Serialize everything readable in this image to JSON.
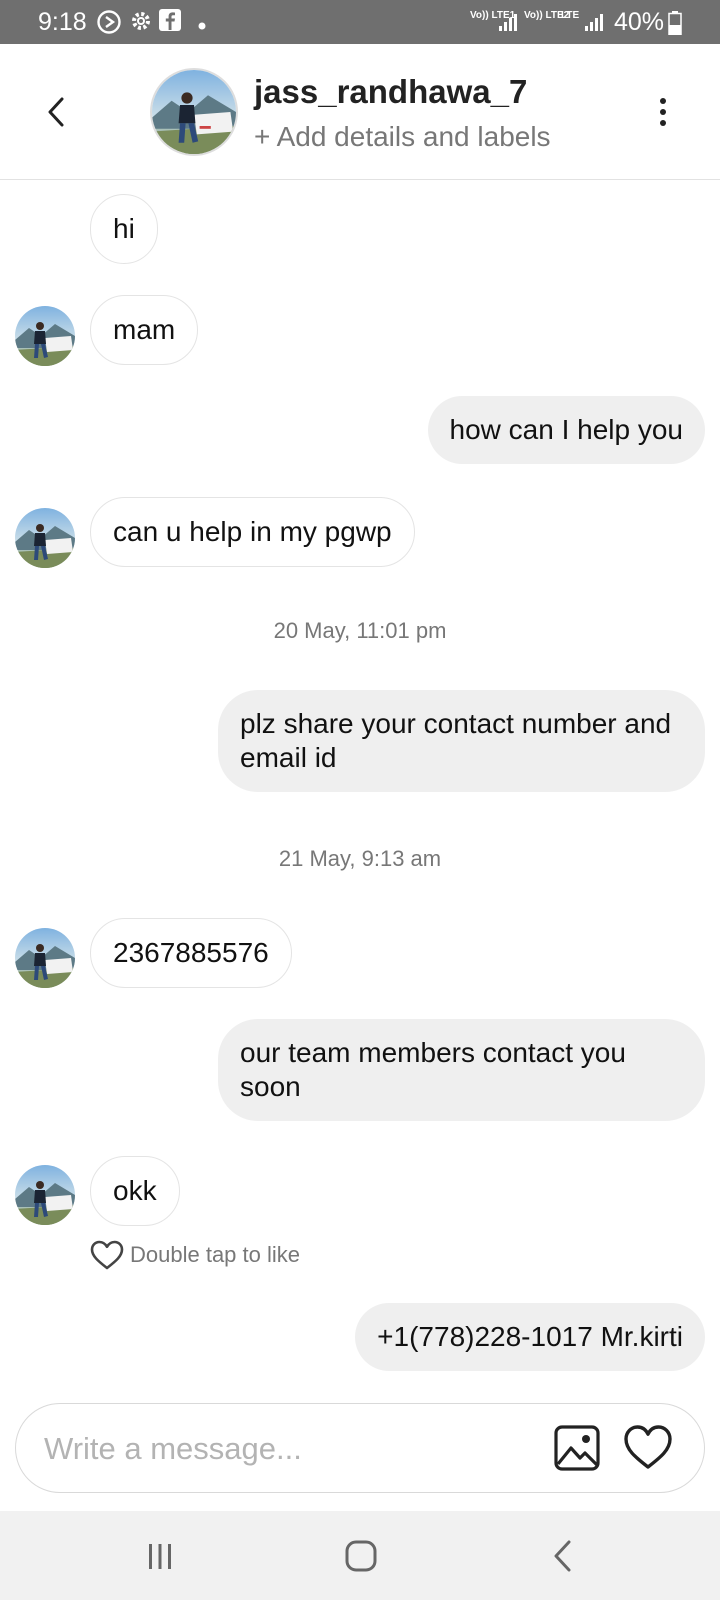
{
  "status_bar": {
    "time": "9:18",
    "battery": "40%",
    "sim1": "Vo)) LTE1",
    "sim2": "Vo)) LTE2",
    "network": "LTE",
    "icons": [
      "whatsapp-icon",
      "settings-icon",
      "facebook-icon",
      "dot-icon",
      "signal-icon",
      "battery-icon"
    ]
  },
  "header": {
    "username": "jass_randhawa_7",
    "subtitle": "+ Add details and labels",
    "icons": [
      "back-arrow-icon",
      "avatar",
      "more-vertical-icon"
    ]
  },
  "messages": [
    {
      "direction": "in",
      "text": "hi",
      "avatar": false
    },
    {
      "direction": "in",
      "text": "mam",
      "avatar": true
    },
    {
      "direction": "out",
      "text": "how can I help you"
    },
    {
      "direction": "in",
      "text": "can u help in my pgwp",
      "avatar": true
    },
    {
      "type": "timestamp",
      "text": "20 May, 11:01 pm"
    },
    {
      "direction": "out",
      "text": "plz share your contact number and email id"
    },
    {
      "type": "timestamp",
      "text": "21 May, 9:13 am"
    },
    {
      "direction": "in",
      "text": "2367885576",
      "avatar": true
    },
    {
      "direction": "out",
      "text": "our team members contact you soon"
    },
    {
      "direction": "in",
      "text": "okk",
      "avatar": true
    },
    {
      "direction": "out",
      "text": "+1(778)228-1017 Mr.kirti"
    }
  ],
  "like_hint": "Double tap to like",
  "composer": {
    "placeholder": "Write a message...",
    "icons": [
      "gallery-icon",
      "heart-icon"
    ]
  },
  "nav_bar": {
    "icons": [
      "recent-apps-icon",
      "home-icon",
      "back-icon"
    ]
  },
  "colors": {
    "status_bar": "#6f6f6f",
    "incoming_bubble": "#ffffff",
    "outgoing_bubble": "#efefef",
    "muted_text": "#777777",
    "nav_bar": "#f1f1f1"
  }
}
